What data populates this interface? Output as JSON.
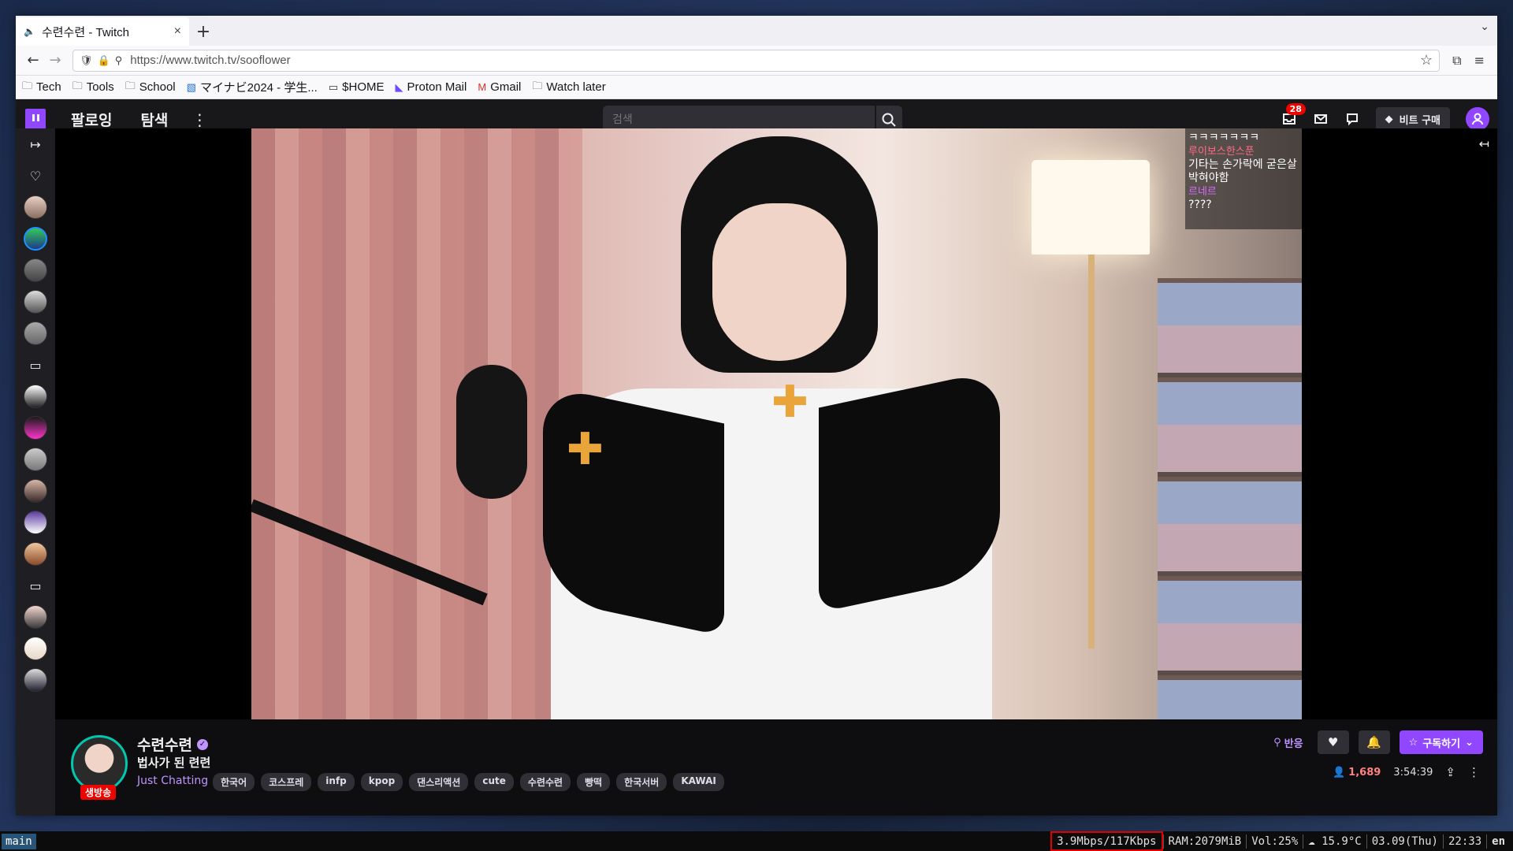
{
  "browser": {
    "tab_title": "수련수련 - Twitch",
    "tab_close": "×",
    "new_tab": "+",
    "url": "https://www.twitch.tv/sooflower",
    "bookmarks": [
      {
        "label": "Tech",
        "icon": "folder-icon"
      },
      {
        "label": "Tools",
        "icon": "folder-icon"
      },
      {
        "label": "School",
        "icon": "folder-icon"
      },
      {
        "label": "マイナビ2024 - 学生...",
        "icon": "mynavi-icon"
      },
      {
        "label": "$HOME",
        "icon": "page-icon"
      },
      {
        "label": "Proton Mail",
        "icon": "proton-icon"
      },
      {
        "label": "Gmail",
        "icon": "gmail-icon"
      },
      {
        "label": "Watch later",
        "icon": "folder-icon"
      }
    ]
  },
  "twitch": {
    "nav": {
      "following": "팔로잉",
      "browse": "탐색"
    },
    "search_placeholder": "검색",
    "notifications_count": "28",
    "bits_label": "비트 구매",
    "accent": "#9147ff"
  },
  "chat_overlay": [
    {
      "text": "ㅋㅋㅋㅋㅋㅋㅋ",
      "type": "msg"
    },
    {
      "text": "루이보스한스푼",
      "type": "name"
    },
    {
      "text": "기타는 손가락에 굳은살 박혀야함",
      "type": "msg"
    },
    {
      "text": "르네르",
      "type": "name2"
    },
    {
      "text": "????",
      "type": "msg"
    }
  ],
  "channel": {
    "name": "수련수련",
    "live_badge": "생방송",
    "title": "법사가 된 련련",
    "category": "Just Chatting",
    "tags": [
      "한국어",
      "코스프레",
      "infp",
      "kpop",
      "댄스리액션",
      "cute",
      "수련수련",
      "빵떡",
      "한국서버",
      "KAWAI"
    ],
    "react_label": "반응",
    "subscribe_label": "구독하기",
    "viewers": "1,689",
    "uptime": "3:54:39"
  },
  "statusbar": {
    "workspace": "main",
    "network": "3.9Mbps/117Kbps",
    "ram": "RAM:2079MiB",
    "volume": "Vol:25%",
    "weather": "15.9°C",
    "date": "03.09(Thu)",
    "time": "22:33",
    "lang": "en"
  }
}
